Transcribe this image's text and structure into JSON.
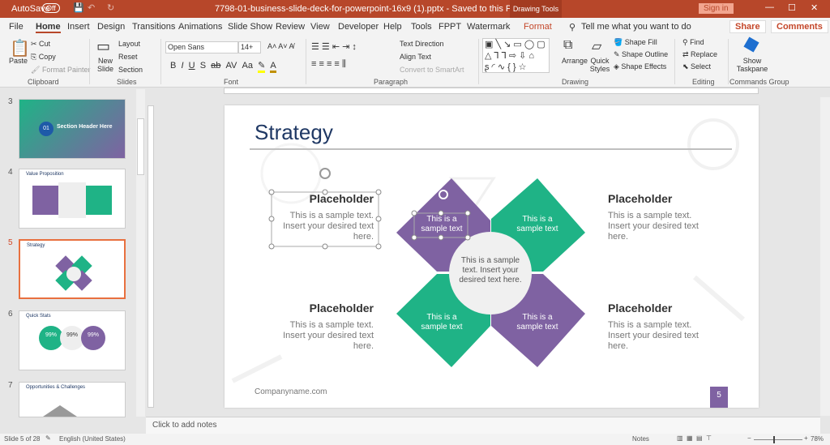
{
  "titlebar": {
    "autosave": "AutoSave",
    "autosave_state": "Off",
    "filename": "7798-01-business-slide-deck-for-powerpoint-16x9 (1).pptx  -  Saved to this PC",
    "context": "Drawing Tools",
    "signin": "Sign in"
  },
  "tabs": [
    "File",
    "Home",
    "Insert",
    "Design",
    "Transitions",
    "Animations",
    "Slide Show",
    "Review",
    "View",
    "Developer",
    "Help",
    "Tools",
    "FPPT",
    "Watermark",
    "Format"
  ],
  "tell_me": "Tell me what you want to do",
  "share": "Share",
  "comments": "Comments",
  "ribbon": {
    "clipboard": {
      "paste": "Paste",
      "cut": "Cut",
      "copy": "Copy",
      "format_painter": "Format Painter",
      "label": "Clipboard"
    },
    "slides": {
      "new_slide": "New Slide",
      "layout": "Layout",
      "reset": "Reset",
      "section": "Section",
      "label": "Slides"
    },
    "font": {
      "name": "Open Sans",
      "size": "14+",
      "label": "Font"
    },
    "paragraph": {
      "text_direction": "Text Direction",
      "align_text": "Align Text",
      "smartart": "Convert to SmartArt",
      "label": "Paragraph"
    },
    "drawing": {
      "arrange": "Arrange",
      "quick_styles": "Quick Styles",
      "shape_fill": "Shape Fill",
      "shape_outline": "Shape Outline",
      "shape_effects": "Shape Effects",
      "label": "Drawing"
    },
    "editing": {
      "find": "Find",
      "replace": "Replace",
      "select": "Select",
      "label": "Editing"
    },
    "commands": {
      "show_taskpane": "Show Taskpane",
      "label": "Commands Group"
    }
  },
  "thumbnails": [
    {
      "num": "3",
      "title": "Section Header Here",
      "badge": "01"
    },
    {
      "num": "4",
      "title": "Value Proposition"
    },
    {
      "num": "5",
      "title": "Strategy",
      "selected": true
    },
    {
      "num": "6",
      "title": "Quick Stats",
      "stat": "99%"
    },
    {
      "num": "7",
      "title": "Opportunities & Challenges"
    }
  ],
  "slide": {
    "title": "Strategy",
    "placeholders": [
      {
        "title": "Placeholder",
        "body": "This is a sample text. Insert your desired text here."
      },
      {
        "title": "Placeholder",
        "body": "This is a sample text. Insert your desired text here."
      },
      {
        "title": "Placeholder",
        "body": "This is a sample text. Insert your desired text here."
      },
      {
        "title": "Placeholder",
        "body": "This is a sample text. Insert your desired text here."
      }
    ],
    "diamonds": [
      "This is a sample text",
      "This is a sample text",
      "This is a sample text",
      "This is a sample text"
    ],
    "center": "This is a sample text. Insert your desired text here.",
    "footer": "Companyname.com",
    "page": "5",
    "colors": {
      "purple": "#7f62a2",
      "green": "#1fb386",
      "title": "#1f3864"
    }
  },
  "notes": "Click to add notes",
  "status": {
    "slide": "Slide 5 of 28",
    "language": "English (United States)",
    "notes": "Notes",
    "zoom": "78%"
  }
}
